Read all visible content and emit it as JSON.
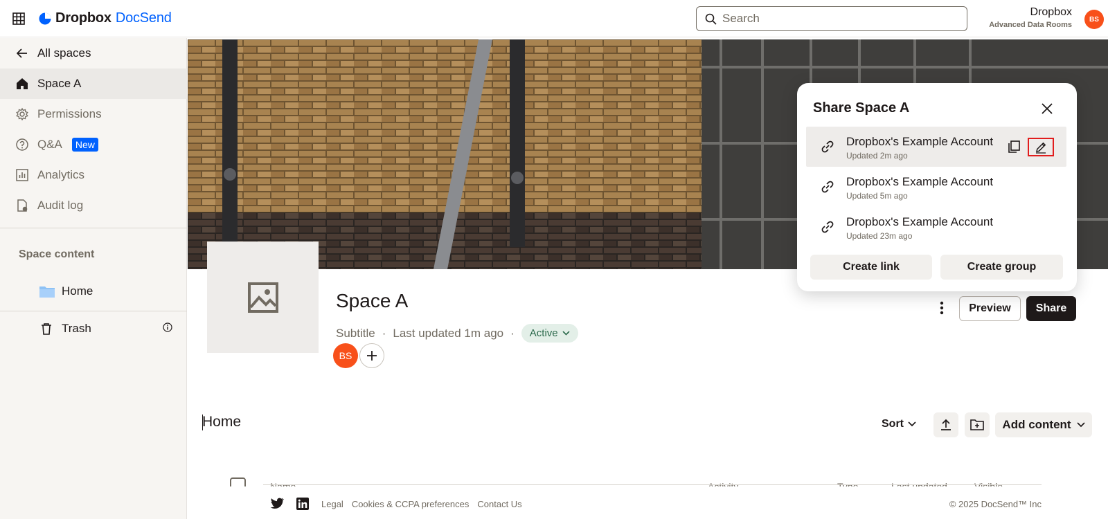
{
  "topbar": {
    "brand_a": "Dropbox",
    "brand_b": "DocSend",
    "search_placeholder": "Search",
    "account_name": "Dropbox",
    "account_plan": "Advanced Data Rooms",
    "avatar_initials": "BS"
  },
  "sidebar": {
    "back_label": "All spaces",
    "items": [
      {
        "label": "Space A",
        "icon": "home-icon",
        "active": true
      },
      {
        "label": "Permissions",
        "icon": "gear-icon"
      },
      {
        "label": "Q&A",
        "icon": "question-icon",
        "badge": "New"
      },
      {
        "label": "Analytics",
        "icon": "chart-icon"
      },
      {
        "label": "Audit log",
        "icon": "audit-icon"
      }
    ],
    "section_title": "Space content",
    "tree": [
      {
        "label": "Home",
        "icon": "folder-icon"
      },
      {
        "label": "Trash",
        "icon": "trash-icon"
      }
    ]
  },
  "space": {
    "title": "Space A",
    "subtitle": "Subtitle",
    "separator": "·",
    "last_updated": "Last updated 1m ago",
    "status": "Active",
    "member_initials": "BS",
    "preview_label": "Preview",
    "share_label": "Share"
  },
  "home": {
    "title": "Home",
    "sort_label": "Sort",
    "add_content_label": "Add content",
    "columns": [
      "Name",
      "Activity",
      "Type",
      "Last updated",
      "Visible"
    ]
  },
  "share_popover": {
    "title": "Share Space A",
    "links": [
      {
        "name": "Dropbox's Example Account",
        "updated": "Updated 2m ago"
      },
      {
        "name": "Dropbox's Example Account",
        "updated": "Updated 5m ago"
      },
      {
        "name": "Dropbox's Example Account",
        "updated": "Updated 23m ago"
      }
    ],
    "create_link_label": "Create link",
    "create_group_label": "Create group"
  },
  "footer": {
    "links": [
      "Legal",
      "Cookies & CCPA preferences",
      "Contact Us"
    ],
    "copyright": "© 2025 DocSend™ Inc"
  },
  "colors": {
    "accent_blue": "#0061fe",
    "avatar_orange": "#f8501a",
    "highlight_red": "#e11d1d",
    "dark_button": "#1e1919"
  }
}
